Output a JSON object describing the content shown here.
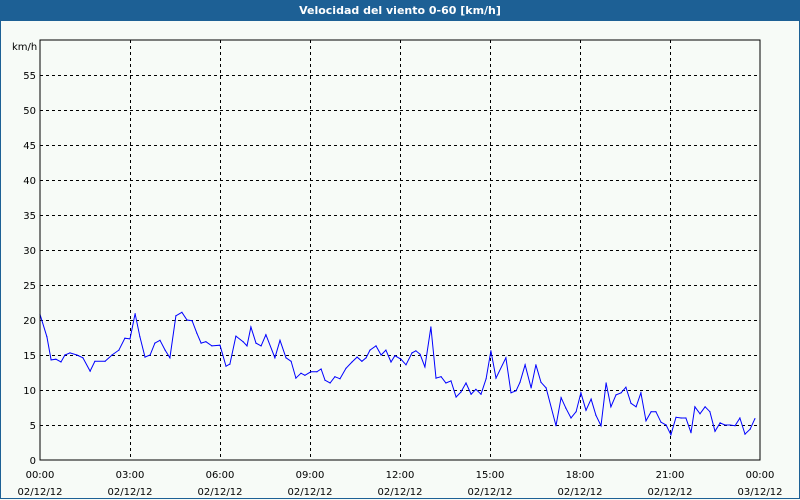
{
  "chart_data": {
    "type": "line",
    "title": "Velocidad del viento 0-60 [km/h]",
    "ylabel": "km/h",
    "xlabel": "",
    "ylim": [
      0,
      60
    ],
    "xlim_hours": [
      0,
      24
    ],
    "grid": true,
    "y_ticks": [
      "0",
      "5",
      "10",
      "15",
      "20",
      "25",
      "30",
      "35",
      "40",
      "45",
      "50",
      "55"
    ],
    "x_ticks": [
      {
        "time": "00:00",
        "date": "02/12/12"
      },
      {
        "time": "03:00",
        "date": "02/12/12"
      },
      {
        "time": "06:00",
        "date": "02/12/12"
      },
      {
        "time": "09:00",
        "date": "02/12/12"
      },
      {
        "time": "12:00",
        "date": "02/12/12"
      },
      {
        "time": "15:00",
        "date": "02/12/12"
      },
      {
        "time": "18:00",
        "date": "02/12/12"
      },
      {
        "time": "21:00",
        "date": "02/12/12"
      },
      {
        "time": "00:00",
        "date": "03/12/12"
      }
    ],
    "series": [
      {
        "name": "Velocidad del viento",
        "color": "#0000ff",
        "x_hours": [
          0,
          0.23,
          0.37,
          0.53,
          0.7,
          0.83,
          1.0,
          1.23,
          1.43,
          1.67,
          1.83,
          2.17,
          2.4,
          2.63,
          2.83,
          3.0,
          3.17,
          3.33,
          3.5,
          3.67,
          3.83,
          4.0,
          4.17,
          4.33,
          4.53,
          4.73,
          4.9,
          5.07,
          5.23,
          5.37,
          5.53,
          5.73,
          6.0,
          6.2,
          6.33,
          6.53,
          6.77,
          6.9,
          7.03,
          7.2,
          7.37,
          7.53,
          7.83,
          8.0,
          8.2,
          8.37,
          8.53,
          8.7,
          8.83,
          9.03,
          9.23,
          9.37,
          9.5,
          9.67,
          9.83,
          10.0,
          10.2,
          10.4,
          10.57,
          10.73,
          10.87,
          11.0,
          11.2,
          11.37,
          11.53,
          11.7,
          11.83,
          12.03,
          12.2,
          12.4,
          12.53,
          12.67,
          12.83,
          13.03,
          13.2,
          13.37,
          13.53,
          13.7,
          13.87,
          14.03,
          14.2,
          14.37,
          14.53,
          14.7,
          14.87,
          15.03,
          15.2,
          15.53,
          15.7,
          15.87,
          16.0,
          16.17,
          16.37,
          16.53,
          16.7,
          16.87,
          17.2,
          17.37,
          17.53,
          17.7,
          17.87,
          18.03,
          18.2,
          18.37,
          18.53,
          18.7,
          18.87,
          19.03,
          19.2,
          19.37,
          19.53,
          19.7,
          19.87,
          20.03,
          20.2,
          20.37,
          20.53,
          20.7,
          20.87,
          21.03,
          21.2,
          21.37,
          21.53,
          21.7,
          21.83,
          22.0,
          22.17,
          22.33,
          22.5,
          22.67,
          22.83,
          23.0,
          23.17,
          23.33,
          23.5,
          23.67,
          23.83
        ],
        "values": [
          20.8,
          17.6,
          14.3,
          14.4,
          14.0,
          15.0,
          15.3,
          15.0,
          14.6,
          12.7,
          14.1,
          14.1,
          15.0,
          15.7,
          17.4,
          17.3,
          20.9,
          17.6,
          14.7,
          15.0,
          16.7,
          17.1,
          15.7,
          14.6,
          20.6,
          21.1,
          20.0,
          19.9,
          18.1,
          16.7,
          16.9,
          16.3,
          16.4,
          13.4,
          13.7,
          17.7,
          16.9,
          16.3,
          19.0,
          16.7,
          16.3,
          17.9,
          14.6,
          17.1,
          14.6,
          14.1,
          11.7,
          12.4,
          12.1,
          12.6,
          12.6,
          13.0,
          11.4,
          11.0,
          11.9,
          11.6,
          13.1,
          14.0,
          14.7,
          14.1,
          14.6,
          15.7,
          16.3,
          15.0,
          15.7,
          14.0,
          14.9,
          14.4,
          13.6,
          15.3,
          15.6,
          15.1,
          13.3,
          19.0,
          11.7,
          11.9,
          11.0,
          11.3,
          9.0,
          9.7,
          11.0,
          9.4,
          10.1,
          9.4,
          11.6,
          15.6,
          11.7,
          14.6,
          9.6,
          9.9,
          11.1,
          13.6,
          10.3,
          13.6,
          11.1,
          10.3,
          4.9,
          8.9,
          7.4,
          6.0,
          6.9,
          9.6,
          7.1,
          8.7,
          6.4,
          4.9,
          11.0,
          7.6,
          9.3,
          9.6,
          10.4,
          8.1,
          7.6,
          9.6,
          5.6,
          6.9,
          6.9,
          5.4,
          5.0,
          3.6,
          6.1,
          6.0,
          6.0,
          3.9,
          7.6,
          6.6,
          7.6,
          6.9,
          4.1,
          5.3,
          5.0,
          5.0,
          4.9,
          6.0,
          3.7,
          4.4,
          5.9
        ]
      }
    ]
  }
}
